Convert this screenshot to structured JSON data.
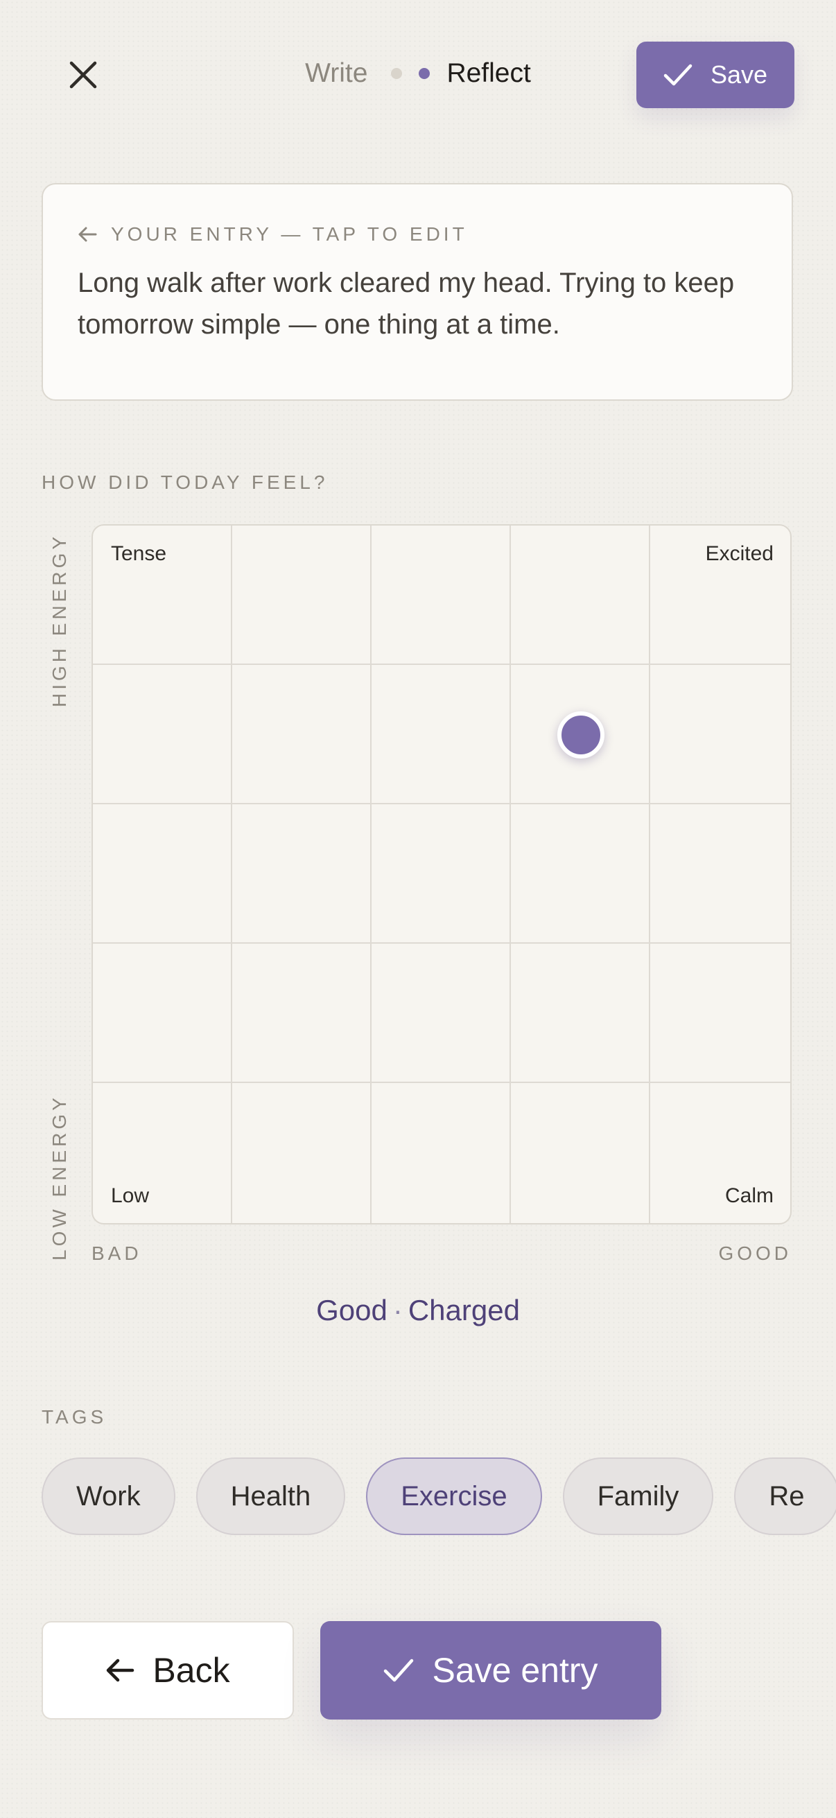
{
  "header": {
    "close_icon": "close-icon",
    "steps": [
      {
        "label": "Write",
        "state": "inactive"
      },
      {
        "label": "Reflect",
        "state": "active"
      }
    ],
    "save_label": "Save",
    "save_icon": "check-icon"
  },
  "entry": {
    "label": "YOUR ENTRY — TAP TO EDIT",
    "label_icon": "arrow-left-icon",
    "text": "Long walk after work cleared my head. Trying to keep tomorrow simple — one thing at a time."
  },
  "mood": {
    "question": "HOW DID TODAY FEEL?",
    "corners": {
      "top_left": "Tense",
      "top_right": "Excited",
      "bottom_left": "Low",
      "bottom_right": "Calm"
    },
    "y_axis": {
      "top": "HIGH ENERGY",
      "bottom": "LOW ENERGY"
    },
    "x_axis": {
      "left": "BAD",
      "right": "GOOD"
    },
    "selection": {
      "valence": 0.7,
      "energy": 0.7
    },
    "result": {
      "valence_label": "Good",
      "separator": "·",
      "energy_label": "Charged"
    },
    "accent_color": "#7b6cab"
  },
  "tags": {
    "label": "TAGS",
    "items": [
      {
        "label": "Work",
        "selected": false
      },
      {
        "label": "Health",
        "selected": false
      },
      {
        "label": "Exercise",
        "selected": true
      },
      {
        "label": "Family",
        "selected": false
      },
      {
        "label": "Re",
        "selected": false
      }
    ]
  },
  "actions": {
    "back_label": "Back",
    "back_icon": "arrow-left-icon",
    "save_entry_label": "Save entry",
    "save_entry_icon": "check-icon"
  }
}
